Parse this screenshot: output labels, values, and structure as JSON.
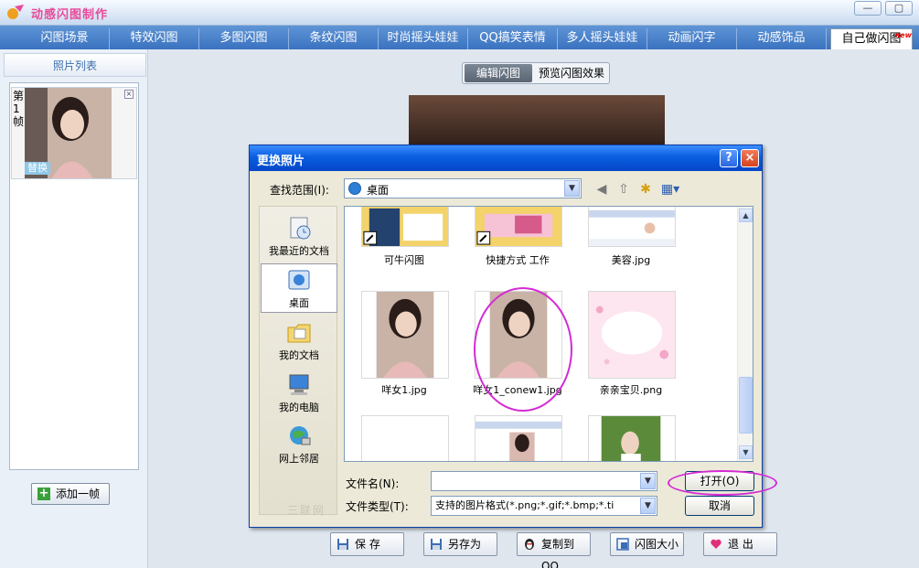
{
  "app": {
    "title": "动感闪图制作",
    "window_buttons": [
      "—",
      "▢"
    ]
  },
  "tabs": [
    {
      "label": "闪图场景"
    },
    {
      "label": "特效闪图"
    },
    {
      "label": "多图闪图"
    },
    {
      "label": "条纹闪图"
    },
    {
      "label": "时尚摇头娃娃"
    },
    {
      "label": "QQ搞笑表情"
    },
    {
      "label": "多人摇头娃娃"
    },
    {
      "label": "动画闪字"
    },
    {
      "label": "动感饰品"
    },
    {
      "label": "自己做闪图",
      "badge": "new",
      "active": true
    }
  ],
  "left_panel": {
    "title": "照片列表",
    "frame": {
      "label": "第1帧",
      "replace": "替换",
      "close": "×"
    },
    "add_button": "添加一帧"
  },
  "main": {
    "mode_tabs": [
      {
        "label": "编辑闪图",
        "active": true
      },
      {
        "label": "预览闪图效果",
        "active": false
      }
    ]
  },
  "bottom_buttons": [
    {
      "label": "保  存",
      "icon": "floppy-icon"
    },
    {
      "label": "另存为",
      "icon": "floppy-icon"
    },
    {
      "label": "复制到QQ",
      "icon": "penguin-icon"
    },
    {
      "label": "闪图大小",
      "icon": "resize-icon"
    },
    {
      "label": "退  出",
      "icon": "heart-icon"
    }
  ],
  "dialog": {
    "title": "更换照片",
    "help": "?",
    "close": "×",
    "lookin_label": "查找范围(I):",
    "lookin_value": "桌面",
    "places": [
      {
        "label": "我最近的文档",
        "icon": "recent-docs-icon"
      },
      {
        "label": "桌面",
        "icon": "desktop-icon",
        "active": true
      },
      {
        "label": "我的文档",
        "icon": "my-documents-icon"
      },
      {
        "label": "我的电脑",
        "icon": "my-computer-icon"
      },
      {
        "label": "网上邻居",
        "icon": "network-icon"
      }
    ],
    "files": [
      {
        "name": "可牛闪图",
        "shortcut": true
      },
      {
        "name": "快捷方式 工作",
        "shortcut": true
      },
      {
        "name": "美容.jpg"
      },
      {
        "name": "咩女1.jpg"
      },
      {
        "name": "咩女1_conew1.jpg",
        "highlighted": true
      },
      {
        "name": "亲亲宝贝.png"
      },
      {
        "name": ""
      },
      {
        "name": ""
      },
      {
        "name": ""
      }
    ],
    "filename_label": "文件名(N):",
    "filename_value": "",
    "filetype_label": "文件类型(T):",
    "filetype_value": "支持的图片格式(*.png;*.gif;*.bmp;*.ti",
    "open_button": "打开(O)",
    "cancel_button": "取消"
  },
  "watermark": "三联网"
}
